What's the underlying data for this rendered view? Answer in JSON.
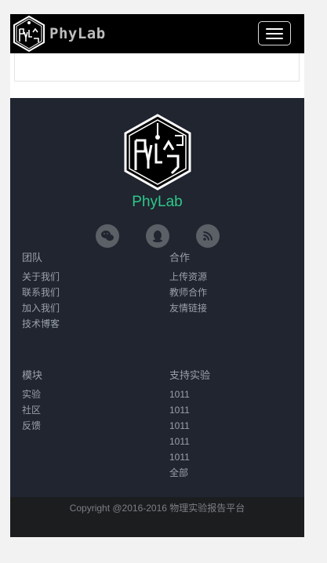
{
  "navbar": {
    "brand": "PhyLab",
    "toggle_icon": "hamburger-menu-icon"
  },
  "footer": {
    "brand": "PhyLab",
    "social": [
      {
        "name": "wechat",
        "icon": "wechat-icon"
      },
      {
        "name": "qq",
        "icon": "qq-icon"
      },
      {
        "name": "rss",
        "icon": "rss-icon"
      }
    ],
    "columns": [
      {
        "title": "团队",
        "links": [
          "关于我们",
          "联系我们",
          "加入我们",
          "技术博客"
        ]
      },
      {
        "title": "合作",
        "links": [
          "上传资源",
          "教师合作",
          "友情链接"
        ]
      },
      {
        "title": "模块",
        "links": [
          "实验",
          "社区",
          "反馈"
        ]
      },
      {
        "title": "支持实验",
        "links": [
          "1011",
          "1011",
          "1011",
          "1011",
          "1011",
          "全部"
        ]
      }
    ],
    "copyright": "Copyright @2016-2016 物理实验报告平台"
  },
  "colors": {
    "navbar_bg": "#000000",
    "footer_bg": "#202530",
    "brand_accent": "#2fc789",
    "copyright_bg": "#1c1d1f"
  }
}
